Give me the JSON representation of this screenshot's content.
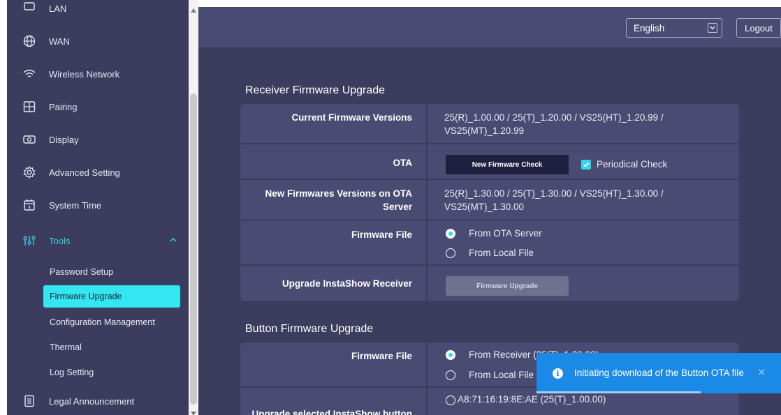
{
  "sidebar": {
    "items": [
      {
        "label": "LAN",
        "icon": "lan-icon"
      },
      {
        "label": "WAN",
        "icon": "globe-icon"
      },
      {
        "label": "Wireless Network",
        "icon": "wifi-icon"
      },
      {
        "label": "Pairing",
        "icon": "pairing-icon"
      },
      {
        "label": "Display",
        "icon": "display-icon"
      },
      {
        "label": "Advanced Setting",
        "icon": "gear-icon"
      },
      {
        "label": "System Time",
        "icon": "calendar-icon"
      },
      {
        "label": "Tools",
        "icon": "tools-icon"
      },
      {
        "label": "Legal Announcement",
        "icon": "document-icon"
      }
    ],
    "tools_submenu": [
      "Password Setup",
      "Firmware Upgrade",
      "Configuration Management",
      "Thermal",
      "Log Setting"
    ],
    "active_color": "#39d3e6",
    "selected_bg": "#33e6f0"
  },
  "header": {
    "language": "English",
    "logout_label": "Logout"
  },
  "receiver": {
    "title": "Receiver Firmware Upgrade",
    "current_label": "Current Firmware Versions",
    "current_value_line1": "25(R)_1.00.00 / 25(T)_1.20.00 / VS25(HT)_1.20.99 /",
    "current_value_line2": "VS25(MT)_1.20.99",
    "ota_label": "OTA",
    "ota_button": "New Firmware Check",
    "periodical_check_label": "Periodical Check",
    "periodical_check_checked": true,
    "new_label_line1": "New Firmwares Versions on OTA",
    "new_label_line2": "Server",
    "new_value_line1": "25(R)_1.30.00 / 25(T)_1.30.00 / VS25(HT)_1.30.00 /",
    "new_value_line2": "VS25(MT)_1.30.00",
    "firmware_file_label": "Firmware File",
    "options": [
      "From OTA Server",
      "From Local File"
    ],
    "selected_option": "From OTA Server",
    "upgrade_label": "Upgrade InstaShow Receiver",
    "upgrade_button": "Firmware Upgrade"
  },
  "button_fw": {
    "title": "Button Firmware Upgrade",
    "firmware_file_label": "Firmware File",
    "options": [
      "From Receiver (25(T)_1.30.00)",
      "From Local File"
    ],
    "selected_option": "From Receiver (25(T)_1.30.00)",
    "upgrade_label": "Upgrade selected InstaShow button",
    "device_option": "A8:71:16:19:8E:AE (25(T)_1.00.00)"
  },
  "toast": {
    "message": "Initiating download of the Button OTA file",
    "icon": "info-icon",
    "close_icon": "close-icon",
    "progress": 0.67,
    "color": "#1a8ae6"
  }
}
